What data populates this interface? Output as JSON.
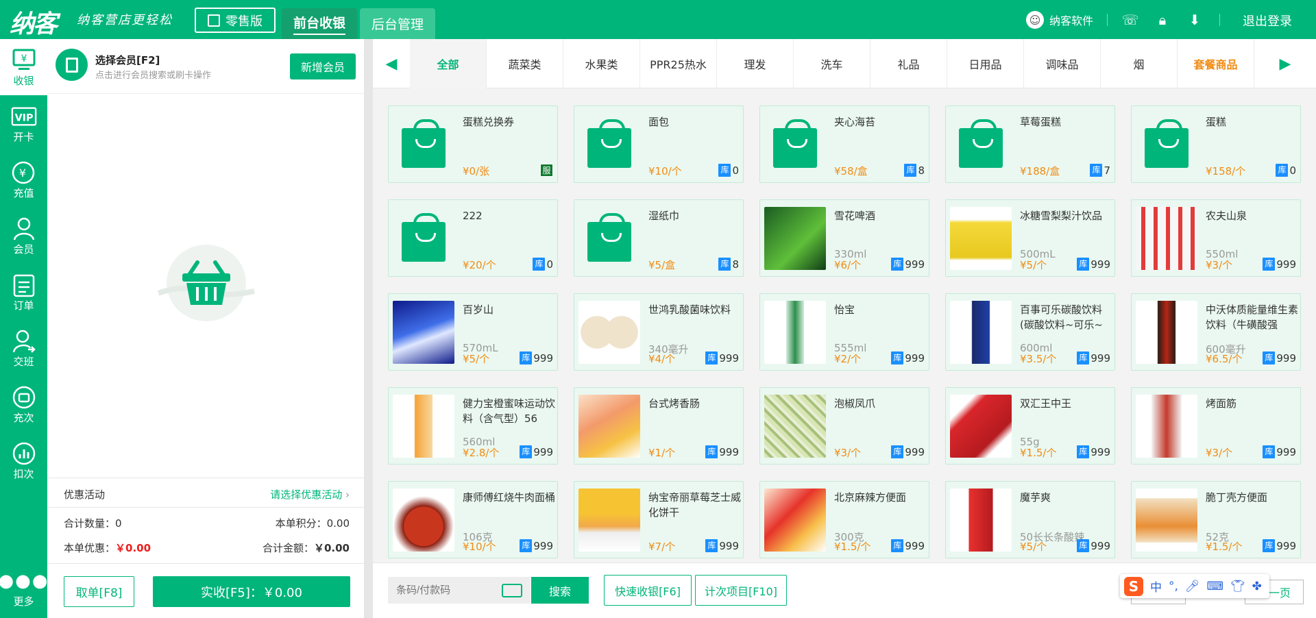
{
  "topbar": {
    "logo": "纳客",
    "slogan": "纳客营店更轻松",
    "edition": "零售版",
    "nav": [
      "前台收银",
      "后台管理"
    ],
    "user": "纳客软件",
    "logout": "退出登录",
    "accent": "#00b57a"
  },
  "sidebar": {
    "items": [
      {
        "label": "收银",
        "icon": "cashier-icon"
      },
      {
        "label": "开卡",
        "icon": "vip-card-icon"
      },
      {
        "label": "充值",
        "icon": "recharge-icon"
      },
      {
        "label": "会员",
        "icon": "member-icon"
      },
      {
        "label": "订单",
        "icon": "order-icon"
      },
      {
        "label": "交班",
        "icon": "shift-icon"
      },
      {
        "label": "充次",
        "icon": "charge-times-icon"
      },
      {
        "label": "扣次",
        "icon": "deduct-times-icon"
      },
      {
        "label": "更多",
        "icon": "more-icon"
      }
    ]
  },
  "member": {
    "title": "选择会员[F2]",
    "hint": "点击进行会员搜索或刷卡操作",
    "add_button": "新增会员",
    "promo_label": "优惠活动",
    "promo_select": "请选择优惠活动",
    "total_qty_label": "合计数量：",
    "total_qty": "0",
    "points_label": "本单积分：",
    "points": "0.00",
    "discount_label": "本单优惠：",
    "discount": "￥0.00",
    "total_amount_label": "合计金额：",
    "total_amount": "￥0.00",
    "cancel_button": "取单[F8]",
    "pay_button": "实收[F5]：￥0.00"
  },
  "categories": [
    "全部",
    "蔬菜类",
    "水果类",
    "PPR25热水",
    "理发",
    "洗车",
    "礼品",
    "日用品",
    "调味品",
    "烟",
    "套餐商品"
  ],
  "products": [
    {
      "name": "蛋糕兑换券",
      "spec": "",
      "price": "¥0/张",
      "badge": "服",
      "stock": ""
    },
    {
      "name": "面包",
      "spec": "",
      "price": "¥10/个",
      "badge": "库",
      "stock": "0"
    },
    {
      "name": "夹心海苔",
      "spec": "",
      "price": "¥58/盒",
      "badge": "库",
      "stock": "8"
    },
    {
      "name": "草莓蛋糕",
      "spec": "",
      "price": "¥188/盒",
      "badge": "库",
      "stock": "7"
    },
    {
      "name": "蛋糕",
      "spec": "",
      "price": "¥158/个",
      "badge": "库",
      "stock": "0"
    },
    {
      "name": "222",
      "spec": "",
      "price": "¥20/个",
      "badge": "库",
      "stock": "0"
    },
    {
      "name": "湿纸巾",
      "spec": "",
      "price": "¥5/盒",
      "badge": "库",
      "stock": "8"
    },
    {
      "name": "雪花啤酒",
      "spec": "330ml",
      "price": "¥6/个",
      "badge": "库",
      "stock": "999"
    },
    {
      "name": "冰糖雪梨梨汁饮品",
      "spec": "500mL",
      "price": "¥5/个",
      "badge": "库",
      "stock": "999"
    },
    {
      "name": "农夫山泉",
      "spec": "550ml",
      "price": "¥3/个",
      "badge": "库",
      "stock": "999"
    },
    {
      "name": "百岁山",
      "spec": "570mL",
      "price": "¥5/个",
      "badge": "库",
      "stock": "999"
    },
    {
      "name": "世鸿乳酸菌味饮料",
      "spec": "340毫升",
      "price": "¥4/个",
      "badge": "库",
      "stock": "999"
    },
    {
      "name": "怡宝",
      "spec": "555ml",
      "price": "¥2/个",
      "badge": "库",
      "stock": "999"
    },
    {
      "name": "百事可乐碳酸饮料(碳酸饮料~可乐~",
      "spec": "600ml",
      "price": "¥3.5/个",
      "badge": "库",
      "stock": "999"
    },
    {
      "name": "中沃体质能量维生素饮料（牛磺酸强",
      "spec": "600毫升",
      "price": "¥6.5/个",
      "badge": "库",
      "stock": "999"
    },
    {
      "name": "健力宝橙蜜味运动饮料（含气型）56",
      "spec": "560ml",
      "price": "¥2.8/个",
      "badge": "库",
      "stock": "999"
    },
    {
      "name": "台式烤香肠",
      "spec": "",
      "price": "¥1/个",
      "badge": "库",
      "stock": "999"
    },
    {
      "name": "泡椒凤爪",
      "spec": "",
      "price": "¥3/个",
      "badge": "库",
      "stock": "999"
    },
    {
      "name": "双汇王中王",
      "spec": "55g",
      "price": "¥1.5/个",
      "badge": "库",
      "stock": "999"
    },
    {
      "name": "烤面筋",
      "spec": "",
      "price": "¥3/个",
      "badge": "库",
      "stock": "999"
    },
    {
      "name": "康师傅红烧牛肉面桶",
      "spec": "106克",
      "price": "¥10/个",
      "badge": "库",
      "stock": "999"
    },
    {
      "name": "纳宝帝丽草莓芝士威化饼干",
      "spec": "",
      "price": "¥7/个",
      "badge": "库",
      "stock": "999"
    },
    {
      "name": "北京麻辣方便面",
      "spec": "300克",
      "price": "¥1.5/个",
      "badge": "库",
      "stock": "999"
    },
    {
      "name": "魔芋爽",
      "spec": "50长长条酸辣",
      "price": "¥5/个",
      "badge": "库",
      "stock": "999"
    },
    {
      "name": "脆丁壳方便面",
      "spec": "52克",
      "price": "¥1.5/个",
      "badge": "库",
      "stock": "999"
    }
  ],
  "bottom": {
    "scan_placeholder": "条码/付款码",
    "search_button": "搜索",
    "quick_cash": "快速收银[F6]",
    "count_items": "计次项目[F10]",
    "prev_page": "上一页",
    "next_page": "下一页"
  },
  "ime": {
    "logo": "S",
    "mode": "中",
    "punct": "°,"
  }
}
